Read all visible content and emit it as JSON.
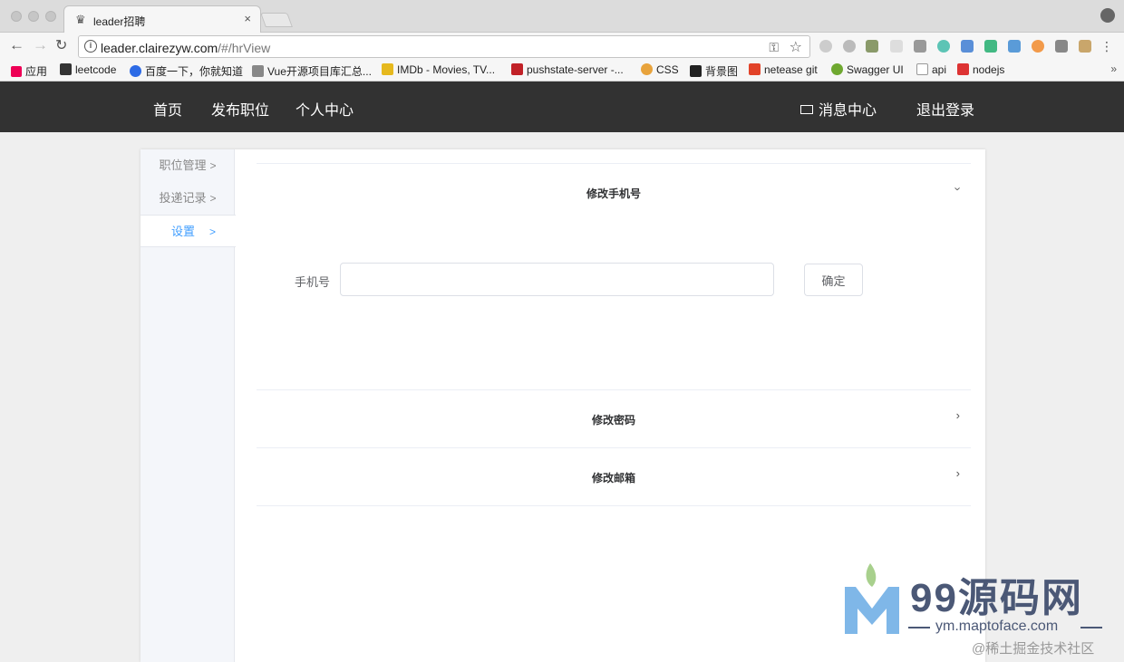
{
  "browser": {
    "tab_title": "leader招聘",
    "tab_close": "×",
    "url_host": "leader.clairezyw.com",
    "url_path": "/#/hrView",
    "bookmarks": [
      "应用",
      "leetcode",
      "百度一下，你就知道",
      "Vue开源项目库汇总...",
      "IMDb - Movies, TV...",
      "pushstate-server -...",
      "CSS",
      "背景图",
      "netease git",
      "Swagger UI",
      "api",
      "nodejs"
    ],
    "bookmark_more": "»"
  },
  "header": {
    "nav": [
      "首页",
      "发布职位",
      "个人中心"
    ],
    "messages": "消息中心",
    "logout": "退出登录"
  },
  "sidebar": {
    "items": [
      {
        "label": "职位管理",
        "active": false
      },
      {
        "label": "投递记录",
        "active": false
      },
      {
        "label": "设置",
        "active": true
      }
    ],
    "chevron": ">"
  },
  "settings": {
    "sections": [
      {
        "title": "修改手机号",
        "expanded": true
      },
      {
        "title": "修改密码",
        "expanded": false
      },
      {
        "title": "修改邮箱",
        "expanded": false
      }
    ],
    "phone_label": "手机号",
    "phone_value": "",
    "confirm_label": "确定"
  },
  "watermark": {
    "brand": "99源码网",
    "url": "ym.maptoface.com",
    "community": "@稀土掘金技术社区"
  },
  "colors": {
    "header_bg": "#323232",
    "active_link": "#409eff",
    "sidebar_bg": "#f4f6fa"
  }
}
